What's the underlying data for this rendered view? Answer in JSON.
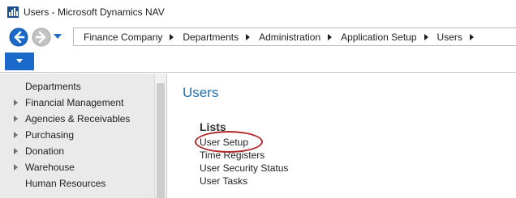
{
  "window": {
    "title": "Users - Microsoft Dynamics NAV"
  },
  "nav": {
    "back_icon": "back-arrow-icon",
    "forward_icon": "forward-arrow-icon",
    "history_icon": "chevron-down-icon",
    "breadcrumbs": [
      "Finance Company",
      "Departments",
      "Administration",
      "Application Setup",
      "Users"
    ]
  },
  "sidebar": {
    "items": [
      {
        "label": "Departments",
        "expandable": false
      },
      {
        "label": "Financial Management",
        "expandable": true
      },
      {
        "label": "Agencies & Receivables",
        "expandable": true
      },
      {
        "label": "Purchasing",
        "expandable": true
      },
      {
        "label": "Donation",
        "expandable": true
      },
      {
        "label": "Warehouse",
        "expandable": true
      },
      {
        "label": "Human Resources",
        "expandable": false
      }
    ]
  },
  "main": {
    "title": "Users",
    "section_header": "Lists",
    "links": [
      "User Setup",
      "Time Registers",
      "User Security Status",
      "User Tasks"
    ]
  },
  "colors": {
    "accent": "#1b6ac9",
    "title_blue": "#1f6fb0",
    "highlight_circle": "#b02828"
  }
}
